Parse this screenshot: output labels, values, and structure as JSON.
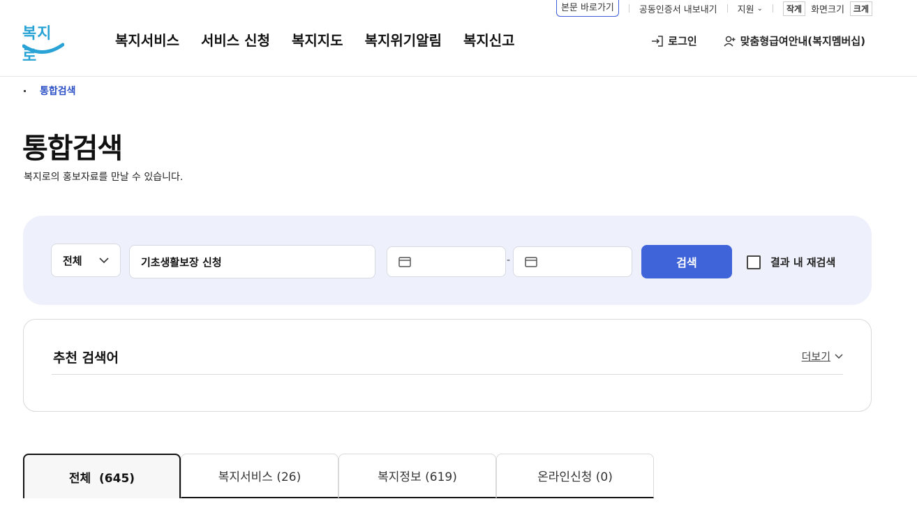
{
  "util": {
    "skip": "본문 바로가기",
    "cert": "공동인증서 내보내기",
    "support": "지원",
    "small": "작게",
    "fontsize": "화면크기",
    "large": "크게"
  },
  "logo": {
    "text": "복지로"
  },
  "gnb": [
    "복지서비스",
    "서비스 신청",
    "복지지도",
    "복지위기알림",
    "복지신고"
  ],
  "header_right": {
    "login": "로그인",
    "membership": "맞춤형급여안내(복지멤버십)"
  },
  "breadcrumb": "통합검색",
  "page": {
    "title": "통합검색",
    "subtitle": "복지로의 홍보자료를 만날 수 있습니다."
  },
  "search": {
    "scope": "전체",
    "keyword": "기초생활보장 신청",
    "date_separator": "-",
    "button": "검색",
    "within": "결과 내 재검색"
  },
  "recommend": {
    "title": "추천 검색어",
    "more": "더보기"
  },
  "tabs": [
    "전체  (645)",
    "복지서비스 (26)",
    "복지정보 (619)",
    "온라인신청 (0)"
  ],
  "colors": {
    "accent": "#3f63d8",
    "logo": "#29a3d6",
    "panel": "#eef1fb"
  }
}
